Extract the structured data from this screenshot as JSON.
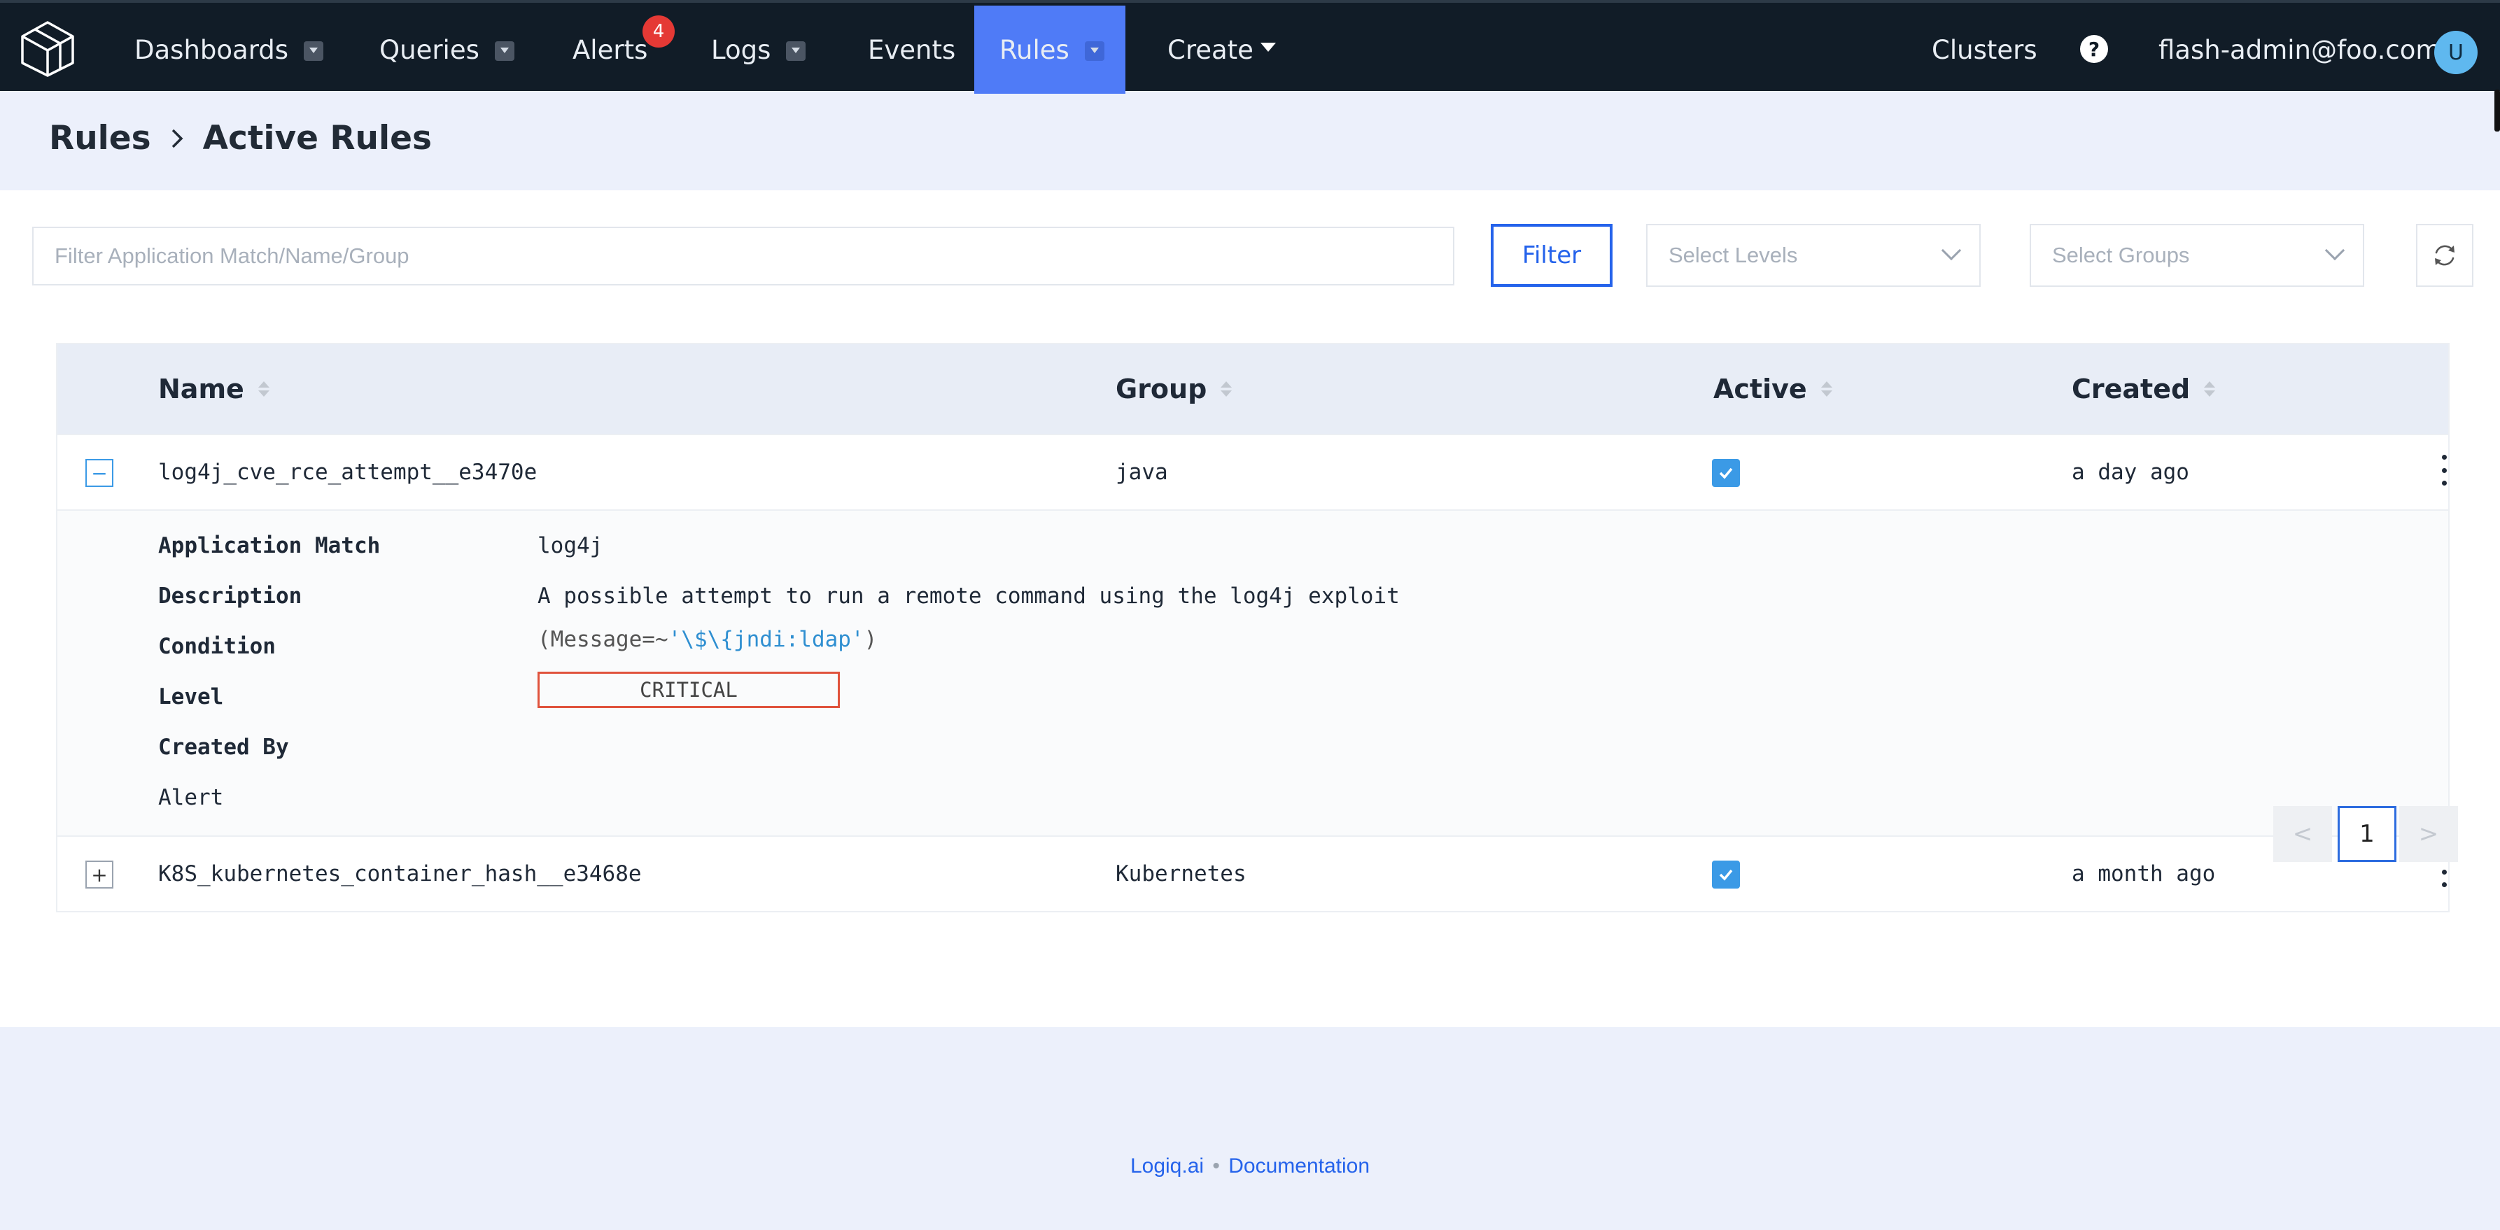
{
  "nav": {
    "items": [
      {
        "label": "Dashboards"
      },
      {
        "label": "Queries"
      },
      {
        "label": "Alerts",
        "badge": "4"
      },
      {
        "label": "Logs"
      },
      {
        "label": "Events"
      },
      {
        "label": "Rules"
      },
      {
        "label": "Create"
      }
    ],
    "clusters": "Clusters",
    "help": "?",
    "user_email": "flash-admin@foo.com",
    "avatar_initial": "U"
  },
  "breadcrumb": {
    "root": "Rules",
    "current": "Active Rules"
  },
  "filters": {
    "search_placeholder": "Filter Application Match/Name/Group",
    "filter_button": "Filter",
    "levels_placeholder": "Select Levels",
    "groups_placeholder": "Select Groups"
  },
  "table": {
    "columns": {
      "name": "Name",
      "group": "Group",
      "active": "Active",
      "created": "Created"
    },
    "rows": [
      {
        "toggle": "−",
        "name": "log4j_cve_rce_attempt__e3470e",
        "group": "java",
        "created": "a day ago"
      },
      {
        "toggle": "+",
        "name": "K8S_kubernetes_container_hash__e3468e",
        "group": "Kubernetes",
        "created": "a month ago"
      }
    ],
    "detail": {
      "app_match_label": "Application Match",
      "app_match_value": "log4j",
      "description_label": "Description",
      "description_value": "A possible attempt to run a remote command using the log4j exploit",
      "condition_label": "Condition",
      "condition_prefix": "(Message=~",
      "condition_string": "'\\$\\{jndi:ldap'",
      "condition_suffix": ")",
      "level_label": "Level",
      "level_value": "CRITICAL",
      "created_by_label": "Created By",
      "alert_label": "Alert"
    }
  },
  "pagination": {
    "prev": "<",
    "page": "1",
    "next": ">"
  },
  "footer": {
    "link1": "Logiq.ai",
    "separator": "•",
    "link2": "Documentation"
  },
  "colors": {
    "nav_bg": "#111c27",
    "accent": "#4f7bf7",
    "badge": "#e53935",
    "level_border": "#e0533d"
  }
}
